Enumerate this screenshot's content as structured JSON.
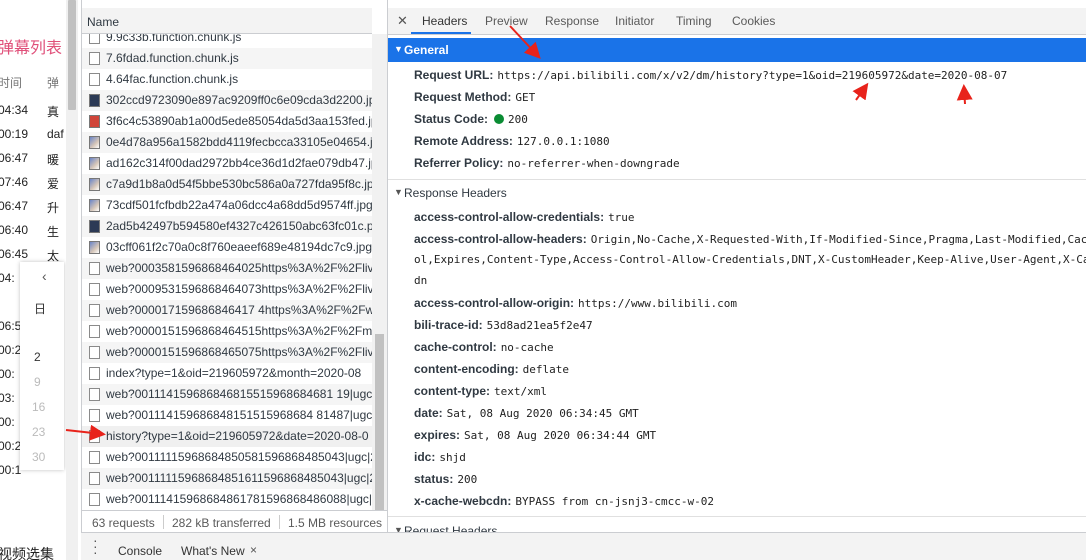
{
  "background_page": {
    "title": "弹幕列表",
    "header_time": "时间",
    "header_text": "弹",
    "rows": [
      {
        "time": "04:34",
        "text": "真"
      },
      {
        "time": "00:19",
        "text": "daf"
      },
      {
        "time": "06:47",
        "text": "暖"
      },
      {
        "time": "07:46",
        "text": "爱"
      },
      {
        "time": "06:47",
        "text": "升"
      },
      {
        "time": "06:40",
        "text": "生"
      },
      {
        "time": "06:45",
        "text": "太"
      },
      {
        "time": "04:",
        "text": ""
      },
      {
        "time": "06:5",
        "text": ""
      },
      {
        "time": "00:2",
        "text": ""
      },
      {
        "time": "00:",
        "text": ""
      },
      {
        "time": "03:",
        "text": ""
      },
      {
        "time": "00:",
        "text": ""
      },
      {
        "time": "00:2",
        "text": ""
      },
      {
        "time": "00:1",
        "text": ""
      },
      {
        "time": "06:5",
        "text": ""
      }
    ],
    "bottom_text": "视频选集",
    "calendar": {
      "prev_arrow": "‹",
      "weekday": "日",
      "days": [
        "2",
        "9",
        "16",
        "23",
        "30"
      ]
    }
  },
  "request_list": {
    "column_header": "Name",
    "requests": [
      {
        "name": "9.9c33b.function.chunk.js",
        "icon": "file-icon"
      },
      {
        "name": "7.6fdad.function.chunk.js",
        "icon": "file-icon"
      },
      {
        "name": "4.64fac.function.chunk.js",
        "icon": "file-icon"
      },
      {
        "name": "302ccd9723090e897ac9209ff0c6e09cda3d2200.jpg",
        "icon": "image-icon"
      },
      {
        "name": "3f6c4c53890ab1a00d5ede85054da5d3aa153fed.jpg",
        "icon": "image-icon"
      },
      {
        "name": "0e4d78a956a1582bdd4119fecbcca33105e04654.jpg",
        "icon": "image-icon"
      },
      {
        "name": "ad162c314f00dad2972bb4ce36d1d2fae079db47.jpg",
        "icon": "image-icon"
      },
      {
        "name": "c7a9d1b8a0d54f5bbe530bc586a0a727fda95f8c.jpg",
        "icon": "image-icon"
      },
      {
        "name": "73cdf501fcfbdb22a474a06dcc4a68dd5d9574ff.jpg",
        "icon": "image-icon"
      },
      {
        "name": "2ad5b42497b594580ef4327c426150abc63fc01c.png",
        "icon": "image-icon"
      },
      {
        "name": "03cff061f2c70a0c8f760eaeef689e48194dc7c9.jpg",
        "icon": "image-icon"
      },
      {
        "name": "web?0003581596868464025https%3A%2F%2Flive.",
        "icon": "file-icon"
      },
      {
        "name": "web?0009531596868464073https%3A%2F%2Flive.",
        "icon": "file-icon"
      },
      {
        "name": "web?000017159686846417 4https%3A%2F%2Fwww.",
        "icon": "file-icon"
      },
      {
        "name": "web?0000151596868464515https%3A%2F%2Fmar",
        "icon": "file-icon"
      },
      {
        "name": "web?0000151596868465075https%3A%2F%2Flive.",
        "icon": "file-icon"
      },
      {
        "name": "index?type=1&oid=219605972&month=2020-08",
        "icon": "file-icon"
      },
      {
        "name": "web?001114159686846815515968684681 19|ugc|2",
        "icon": "file-icon"
      },
      {
        "name": "web?001114159686848151515968684 81487|ugc|2",
        "icon": "file-icon"
      },
      {
        "name": "history?type=1&oid=219605972&date=2020-08-0",
        "icon": "file-icon"
      },
      {
        "name": "web?00111115968684850581596868485043|ugc|2",
        "icon": "file-icon"
      },
      {
        "name": "web?00111115968684851611596868485043|ugc|2",
        "icon": "file-icon"
      },
      {
        "name": "web?00111415968684861781596868486088|ugc|2",
        "icon": "file-icon"
      }
    ],
    "status": {
      "requests": "63 requests",
      "transferred": "282 kB transferred",
      "resources": "1.5 MB resources"
    }
  },
  "details": {
    "tabs": [
      "Headers",
      "Preview",
      "Response",
      "Initiator",
      "Timing",
      "Cookies"
    ],
    "active_tab": "Headers",
    "general": {
      "title": "General",
      "items": [
        {
          "key": "Request URL:",
          "value": "https://api.bilibili.com/x/v2/dm/history?type=1&oid=219605972&date=2020-08-07"
        },
        {
          "key": "Request Method:",
          "value": "GET"
        },
        {
          "key": "Status Code:",
          "value": "200"
        },
        {
          "key": "Remote Address:",
          "value": "127.0.0.1:1080"
        },
        {
          "key": "Referrer Policy:",
          "value": "no-referrer-when-downgrade"
        }
      ]
    },
    "response_headers": {
      "title": "Response Headers",
      "items": [
        {
          "key": "access-control-allow-credentials:",
          "value": "true"
        },
        {
          "key": "access-control-allow-headers:",
          "value": "Origin,No-Cache,X-Requested-With,If-Modified-Since,Pragma,Last-Modified,Cach"
        },
        {
          "key": "",
          "value": "ol,Expires,Content-Type,Access-Control-Allow-Credentials,DNT,X-CustomHeader,Keep-Alive,User-Agent,X-Ca"
        },
        {
          "key": "",
          "value": "dn"
        },
        {
          "key": "access-control-allow-origin:",
          "value": "https://www.bilibili.com"
        },
        {
          "key": "bili-trace-id:",
          "value": "53d8ad21ea5f2e47"
        },
        {
          "key": "cache-control:",
          "value": "no-cache"
        },
        {
          "key": "content-encoding:",
          "value": "deflate"
        },
        {
          "key": "content-type:",
          "value": "text/xml"
        },
        {
          "key": "date:",
          "value": "Sat, 08 Aug 2020 06:34:45 GMT"
        },
        {
          "key": "expires:",
          "value": "Sat, 08 Aug 2020 06:34:44 GMT"
        },
        {
          "key": "idc:",
          "value": "shjd"
        },
        {
          "key": "status:",
          "value": "200"
        },
        {
          "key": "x-cache-webcdn:",
          "value": "BYPASS from cn-jsnj3-cmcc-w-02"
        }
      ]
    },
    "request_headers": {
      "title": "Request Headers"
    }
  },
  "drawer": {
    "tabs": [
      "Console",
      "What's New"
    ],
    "close": "×"
  },
  "colors": {
    "accent": "#1a73e8",
    "status_ok": "#0a8c33",
    "annotation": "#e8231b"
  }
}
